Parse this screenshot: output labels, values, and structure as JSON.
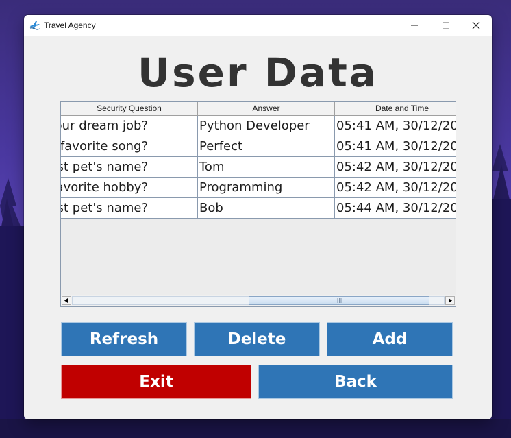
{
  "window": {
    "title": "Travel Agency"
  },
  "page": {
    "heading": "User Data"
  },
  "table": {
    "columns": [
      "Security Question",
      "Answer",
      "Date and Time"
    ],
    "rows": [
      [
        "our dream job?",
        "Python Developer",
        "05:41 AM, 30/12/20"
      ],
      [
        "our favorite song?",
        "Perfect",
        "05:41 AM, 30/12/20"
      ],
      [
        "rst pet's name?",
        "Tom",
        "05:42 AM, 30/12/20"
      ],
      [
        "our favorite hobby?",
        "Programming",
        "05:42 AM, 30/12/20"
      ],
      [
        "rst pet's name?",
        "Bob",
        "05:44 AM, 30/12/20"
      ]
    ]
  },
  "buttons": {
    "refresh": "Refresh",
    "delete": "Delete",
    "add": "Add",
    "exit": "Exit",
    "back": "Back"
  },
  "colors": {
    "button_blue": "#2f75b6",
    "button_red": "#c00000",
    "heading": "#333333"
  },
  "icons": {
    "app": "travel-agency-icon",
    "minimize": "minimize-icon",
    "maximize": "maximize-icon",
    "close": "close-icon"
  }
}
